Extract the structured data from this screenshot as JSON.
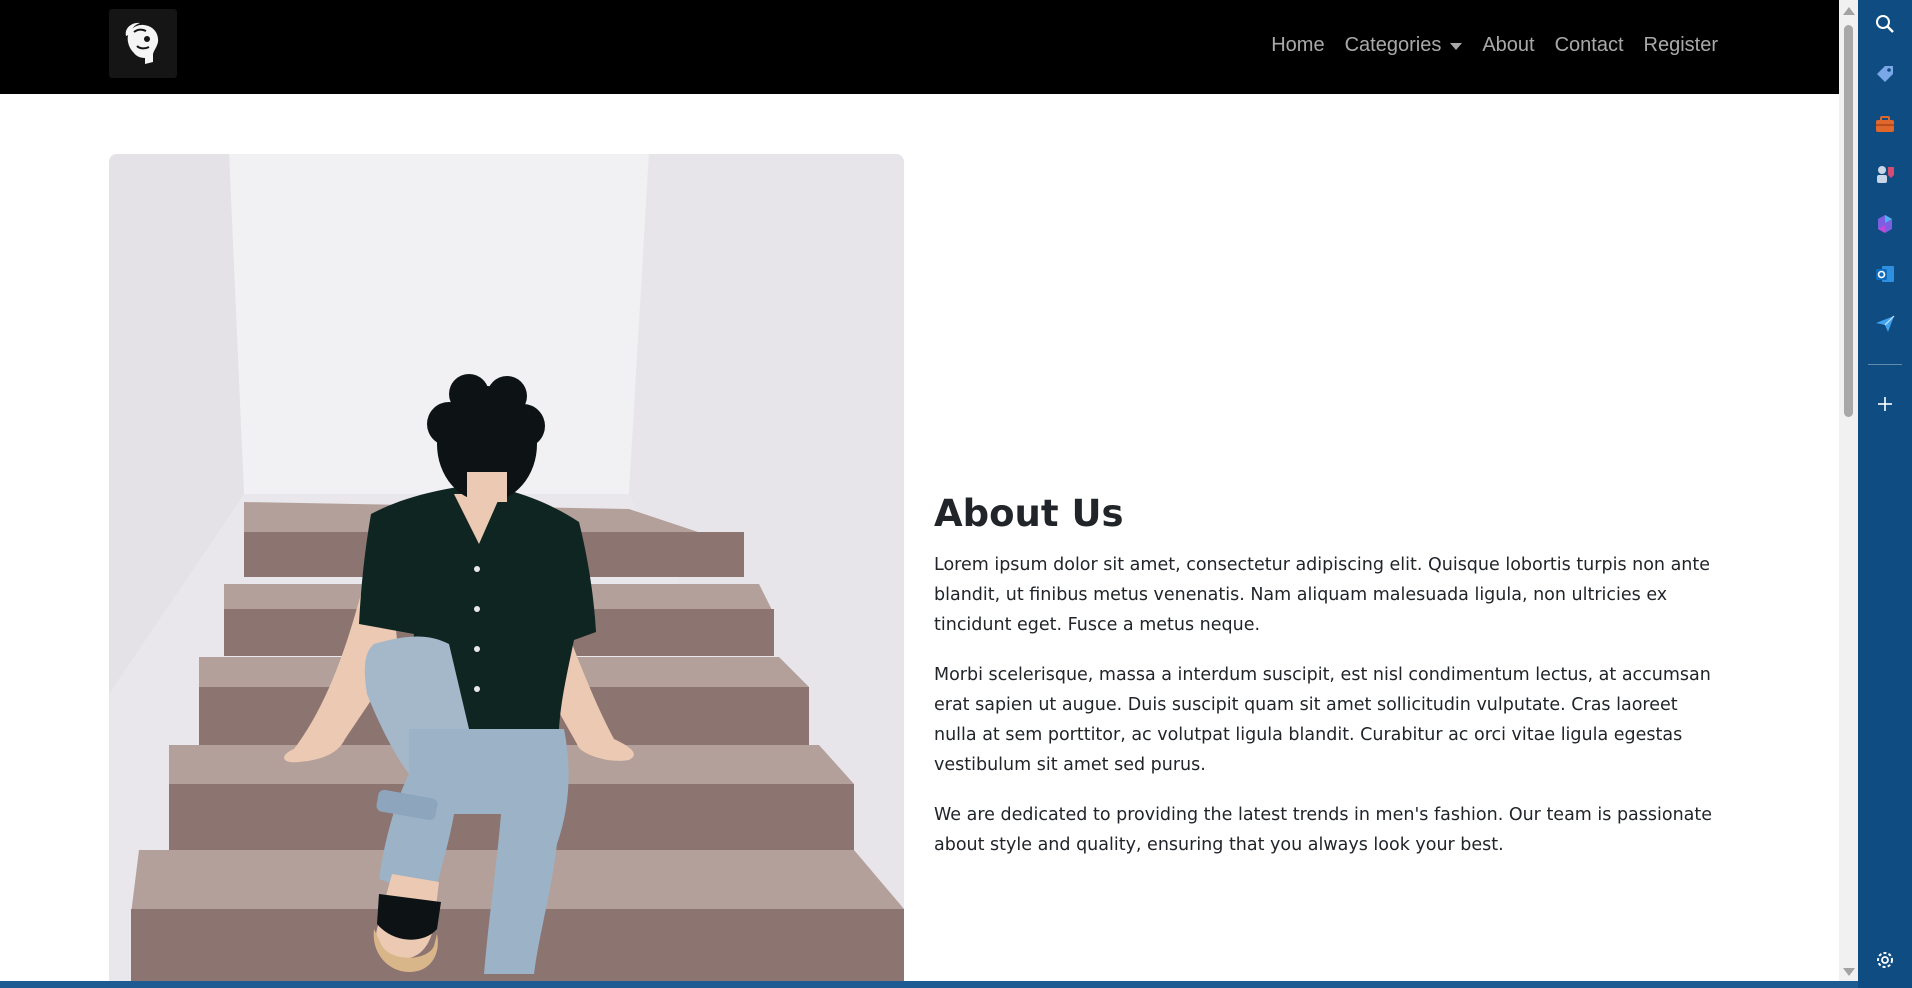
{
  "navbar": {
    "logo_alt": "logo",
    "links": [
      {
        "label": "Home"
      },
      {
        "label": "Categories",
        "has_dropdown": true
      },
      {
        "label": "About"
      },
      {
        "label": "Contact"
      },
      {
        "label": "Register"
      }
    ]
  },
  "about": {
    "heading": "About Us",
    "paragraphs": [
      "Lorem ipsum dolor sit amet, consectetur adipiscing elit. Quisque lobortis turpis non ante blandit, ut finibus metus venenatis. Nam aliquam malesuada ligula, non ultricies ex tincidunt eget. Fusce a metus neque.",
      "Morbi scelerisque, massa a interdum suscipit, est nisl condimentum lectus, at accumsan erat sapien ut augue. Duis suscipit quam sit amet sollicitudin vulputate. Cras laoreet nulla at sem porttitor, ac volutpat ligula blandit. Curabitur ac orci vitae ligula egestas vestibulum sit amet sed purus.",
      "We are dedicated to providing the latest trends in men's fashion. Our team is passionate about style and quality, ensuring that you always look your best."
    ]
  },
  "side_panel": {
    "icons": [
      "search-icon",
      "tag-icon",
      "briefcase-icon",
      "games-icon",
      "copilot-icon",
      "outlook-icon",
      "send-icon",
      "add-icon",
      "settings-icon"
    ]
  },
  "colors": {
    "navbar_bg": "#000000",
    "nav_link": "#a8a8a8",
    "text": "#212529",
    "side_panel": "#0f4c81",
    "stairs": "#b09c97",
    "shirt": "#0f2522",
    "jeans": "#9fb4c8"
  }
}
